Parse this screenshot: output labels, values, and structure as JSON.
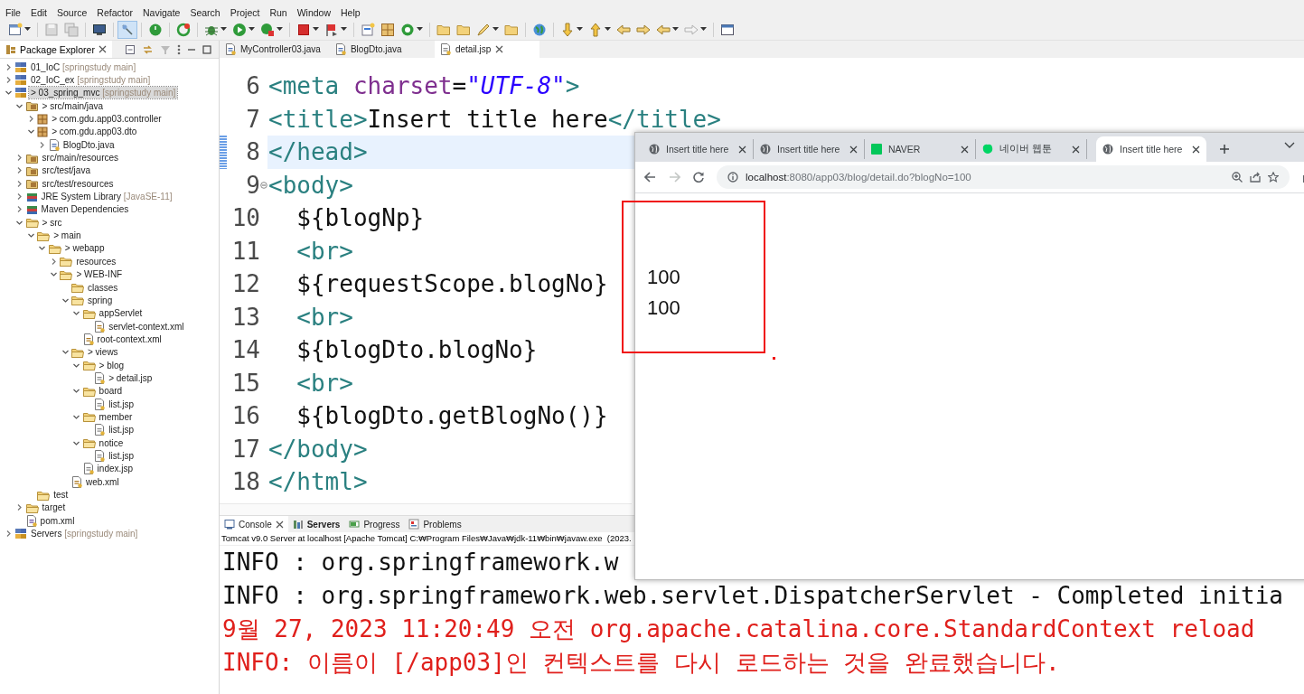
{
  "menu": [
    "File",
    "Edit",
    "Source",
    "Refactor",
    "Navigate",
    "Search",
    "Project",
    "Run",
    "Window",
    "Help"
  ],
  "package_explorer": {
    "title": "Package Explorer",
    "tree": [
      {
        "label": "01_IoC",
        "decoration": "[springstudy main]",
        "kind": "project",
        "expanded": false,
        "selected": false
      },
      {
        "label": "02_IoC_ex",
        "decoration": "[springstudy main]",
        "kind": "project",
        "expanded": false,
        "selected": false
      },
      {
        "label": "> 03_spring_mvc",
        "decoration": "[springstudy main]",
        "kind": "project",
        "expanded": true,
        "selected": true,
        "children": [
          {
            "label": "> src/main/java",
            "kind": "source-folder",
            "expanded": true,
            "selected": false,
            "children": [
              {
                "label": "> com.gdu.app03.controller",
                "kind": "package",
                "expanded": false,
                "selected": false
              },
              {
                "label": "> com.gdu.app03.dto",
                "kind": "package",
                "expanded": true,
                "selected": false,
                "children": [
                  {
                    "label": "BlogDto.java",
                    "kind": "java",
                    "expanded": false,
                    "selected": false
                  }
                ]
              }
            ]
          },
          {
            "label": "src/main/resources",
            "kind": "source-folder",
            "expanded": false,
            "selected": false
          },
          {
            "label": "src/test/java",
            "kind": "source-folder",
            "expanded": false,
            "selected": false
          },
          {
            "label": "src/test/resources",
            "kind": "source-folder",
            "expanded": false,
            "selected": false
          },
          {
            "label": "JRE System Library",
            "decoration": "[JavaSE-11]",
            "kind": "library",
            "expanded": false,
            "selected": false
          },
          {
            "label": "Maven Dependencies",
            "kind": "library",
            "expanded": false,
            "selected": false
          },
          {
            "label": "> src",
            "kind": "folder",
            "expanded": true,
            "selected": false,
            "children": [
              {
                "label": "> main",
                "kind": "folder",
                "expanded": true,
                "selected": false,
                "children": [
                  {
                    "label": "> webapp",
                    "kind": "folder",
                    "expanded": true,
                    "selected": false,
                    "children": [
                      {
                        "label": "resources",
                        "kind": "folder",
                        "expanded": false,
                        "selected": false
                      },
                      {
                        "label": "> WEB-INF",
                        "kind": "folder",
                        "expanded": true,
                        "selected": false,
                        "children": [
                          {
                            "label": "classes",
                            "kind": "folder",
                            "selected": false
                          },
                          {
                            "label": "spring",
                            "kind": "folder",
                            "expanded": true,
                            "selected": false,
                            "children": [
                              {
                                "label": "appServlet",
                                "kind": "folder",
                                "expanded": true,
                                "selected": false,
                                "children": [
                                  {
                                    "label": "servlet-context.xml",
                                    "kind": "xml",
                                    "selected": false
                                  }
                                ]
                              },
                              {
                                "label": "root-context.xml",
                                "kind": "xml",
                                "selected": false
                              }
                            ]
                          },
                          {
                            "label": "> views",
                            "kind": "folder",
                            "expanded": true,
                            "selected": false,
                            "children": [
                              {
                                "label": "> blog",
                                "kind": "folder",
                                "expanded": true,
                                "selected": false,
                                "children": [
                                  {
                                    "label": "> detail.jsp",
                                    "kind": "jsp",
                                    "selected": false
                                  }
                                ]
                              },
                              {
                                "label": "board",
                                "kind": "folder",
                                "expanded": true,
                                "selected": false,
                                "children": [
                                  {
                                    "label": "list.jsp",
                                    "kind": "jsp",
                                    "selected": false
                                  }
                                ]
                              },
                              {
                                "label": "member",
                                "kind": "folder",
                                "expanded": true,
                                "selected": false,
                                "children": [
                                  {
                                    "label": "list.jsp",
                                    "kind": "jsp",
                                    "selected": false
                                  }
                                ]
                              },
                              {
                                "label": "notice",
                                "kind": "folder",
                                "expanded": true,
                                "selected": false,
                                "children": [
                                  {
                                    "label": "list.jsp",
                                    "kind": "jsp",
                                    "selected": false
                                  }
                                ]
                              },
                              {
                                "label": "index.jsp",
                                "kind": "jsp",
                                "selected": false
                              }
                            ]
                          },
                          {
                            "label": "web.xml",
                            "kind": "xml",
                            "selected": false
                          }
                        ]
                      }
                    ]
                  }
                ]
              },
              {
                "label": "test",
                "kind": "folder",
                "selected": false
              }
            ]
          },
          {
            "label": "target",
            "kind": "folder",
            "expanded": false,
            "selected": false
          },
          {
            "label": "pom.xml",
            "kind": "pom",
            "selected": false
          }
        ]
      },
      {
        "label": "Servers",
        "decoration": "[springstudy main]",
        "kind": "project",
        "expanded": false,
        "selected": false
      }
    ]
  },
  "editor": {
    "tabs": [
      {
        "label": "MyController03.java",
        "kind": "java",
        "selected": false
      },
      {
        "label": "BlogDto.java",
        "kind": "java",
        "selected": false
      },
      {
        "label": "detail.jsp",
        "kind": "jsp",
        "selected": true
      }
    ],
    "lines": [
      {
        "number": "6",
        "current": false,
        "changed": false,
        "foldable": false,
        "tokens": [
          {
            "kind": "tag",
            "text": "<meta"
          },
          {
            "kind": "attr",
            "text": " charset"
          },
          {
            "kind": "text",
            "text": "="
          },
          {
            "kind": "string",
            "text": "\"UTF-8\""
          },
          {
            "kind": "tag",
            "text": ">"
          }
        ]
      },
      {
        "number": "7",
        "current": false,
        "changed": false,
        "foldable": false,
        "tokens": [
          {
            "kind": "tag",
            "text": "<title>"
          },
          {
            "kind": "text",
            "text": "Insert title here"
          },
          {
            "kind": "tag",
            "text": "</title>"
          }
        ]
      },
      {
        "number": "8",
        "current": true,
        "changed": true,
        "foldable": false,
        "tokens": [
          {
            "kind": "tag",
            "text": "</head>"
          }
        ]
      },
      {
        "number": "9",
        "current": false,
        "changed": false,
        "foldable": true,
        "tokens": [
          {
            "kind": "tag",
            "text": "<body>"
          }
        ]
      },
      {
        "number": "10",
        "current": false,
        "changed": false,
        "foldable": false,
        "tokens": [
          {
            "kind": "text",
            "text": "  ${blogNp}"
          }
        ]
      },
      {
        "number": "11",
        "current": false,
        "changed": false,
        "foldable": false,
        "tokens": [
          {
            "kind": "tag",
            "text": "  <br>"
          }
        ]
      },
      {
        "number": "12",
        "current": false,
        "changed": false,
        "foldable": false,
        "tokens": [
          {
            "kind": "text",
            "text": "  ${requestScope.blogNo}"
          }
        ]
      },
      {
        "number": "13",
        "current": false,
        "changed": false,
        "foldable": false,
        "tokens": [
          {
            "kind": "tag",
            "text": "  <br>"
          }
        ]
      },
      {
        "number": "14",
        "current": false,
        "changed": false,
        "foldable": false,
        "tokens": [
          {
            "kind": "text",
            "text": "  ${blogDto.blogNo}"
          }
        ]
      },
      {
        "number": "15",
        "current": false,
        "changed": false,
        "foldable": false,
        "tokens": [
          {
            "kind": "tag",
            "text": "  <br>"
          }
        ]
      },
      {
        "number": "16",
        "current": false,
        "changed": false,
        "foldable": false,
        "tokens": [
          {
            "kind": "text",
            "text": "  ${blogDto.getBlogNo()}"
          }
        ]
      },
      {
        "number": "17",
        "current": false,
        "changed": false,
        "foldable": false,
        "tokens": [
          {
            "kind": "tag",
            "text": "</body>"
          }
        ]
      },
      {
        "number": "18",
        "current": false,
        "changed": false,
        "foldable": false,
        "tokens": [
          {
            "kind": "tag",
            "text": "</html>"
          }
        ]
      }
    ]
  },
  "console": {
    "tabs": [
      {
        "label": "Console",
        "kind": "console",
        "selected": true,
        "updated": false
      },
      {
        "label": "Servers",
        "kind": "servers",
        "selected": false,
        "updated": true
      },
      {
        "label": "Progress",
        "kind": "progress",
        "selected": false,
        "updated": false
      },
      {
        "label": "Problems",
        "kind": "problems",
        "selected": false,
        "updated": false
      }
    ],
    "description": "Tomcat v9.0 Server at localhost [Apache Tomcat] C:₩Program Files₩Java₩jdk-11₩bin₩javaw.exe  (2023.",
    "output": [
      {
        "kind": "stdout",
        "text": "INFO : org.springframework.w"
      },
      {
        "kind": "stdout",
        "text": "INFO : org.springframework.web.servlet.DispatcherServlet - Completed initia"
      },
      {
        "kind": "stderr",
        "text": "9월 27, 2023 11:20:49 오전 org.apache.catalina.core.StandardContext reload"
      },
      {
        "kind": "stderr",
        "text": "INFO: 이름이 [/app03]인 컨텍스트를 다시 로드하는 것을 완료했습니다."
      }
    ]
  },
  "browser": {
    "tabs": [
      {
        "title": "Insert title here",
        "kind": "globe",
        "selected": false
      },
      {
        "title": "Insert title here",
        "kind": "globe",
        "selected": false
      },
      {
        "title": "NAVER",
        "kind": "naver",
        "selected": false
      },
      {
        "title": "네이버 웹툰",
        "kind": "webtoon",
        "selected": false
      },
      {
        "title": "Insert title here",
        "kind": "globe",
        "selected": true
      }
    ],
    "address": {
      "host": "localhost",
      "rest": ":8080/app03/blog/detail.do?blogNo=100"
    },
    "content": [
      "100",
      "100"
    ]
  }
}
